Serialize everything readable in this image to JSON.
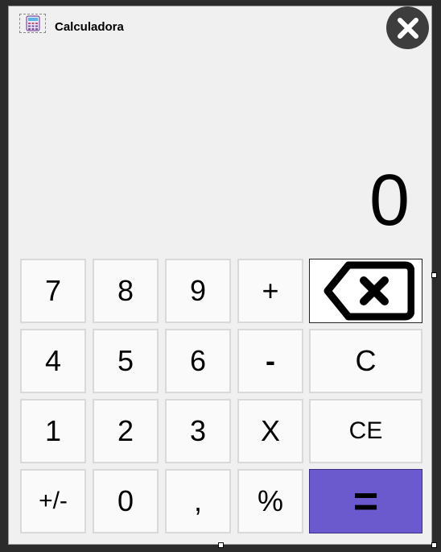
{
  "window": {
    "title": "Calculadora",
    "app_icon": "calculator-icon",
    "close_icon": "close-icon"
  },
  "display": {
    "value": "0"
  },
  "keys": {
    "k7": "7",
    "k8": "8",
    "k9": "9",
    "plus": "+",
    "backspace_icon": "backspace-icon",
    "k4": "4",
    "k5": "5",
    "k6": "6",
    "minus": "-",
    "clear": "C",
    "k1": "1",
    "k2": "2",
    "k3": "3",
    "multiply": "X",
    "clear_entry": "CE",
    "negate": "+/-",
    "k0": "0",
    "comma": ",",
    "percent": "%",
    "equals": "="
  },
  "colors": {
    "window_bg": "#f0f0f0",
    "key_bg": "#fafafa",
    "equals_bg": "#6a5acd",
    "close_bg": "#3d3d3d"
  }
}
